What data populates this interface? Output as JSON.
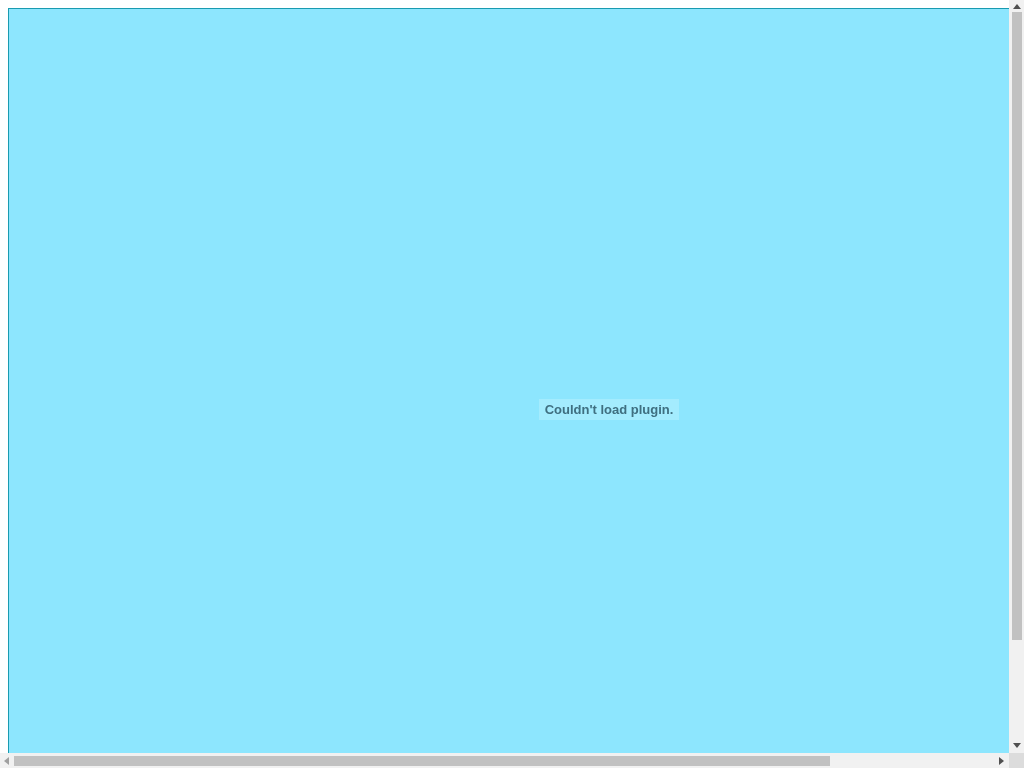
{
  "plugin": {
    "message": "Couldn't load plugin."
  }
}
